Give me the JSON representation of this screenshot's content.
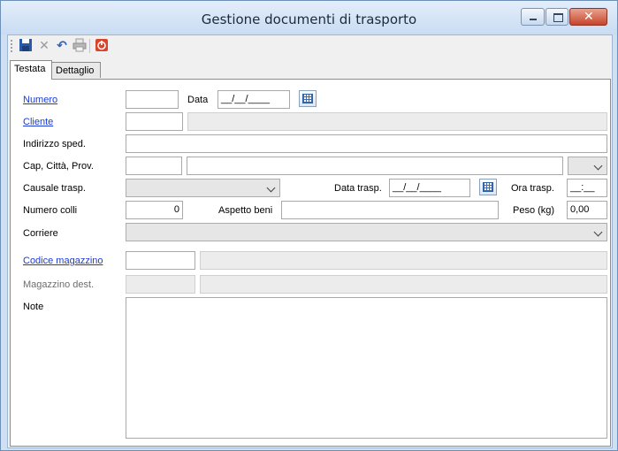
{
  "window": {
    "title": "Gestione documenti di trasporto"
  },
  "toolbar": {
    "save_icon": "save-icon",
    "delete_icon": "delete-icon",
    "undo_icon": "undo-icon",
    "print_icon": "print-icon",
    "exit_icon": "power-icon"
  },
  "tabs": [
    {
      "label": "Testata"
    },
    {
      "label": "Dettaglio"
    }
  ],
  "form": {
    "numero": {
      "label": "Numero",
      "value": ""
    },
    "data": {
      "label": "Data",
      "value": "__/__/____"
    },
    "cliente": {
      "label": "Cliente",
      "code": "",
      "name": ""
    },
    "indirizzo": {
      "label": "Indirizzo sped.",
      "value": ""
    },
    "cap_citta_prov": {
      "label": "Cap, Città, Prov.",
      "cap": "",
      "citta": "",
      "prov": ""
    },
    "causale": {
      "label": "Causale trasp.",
      "value": ""
    },
    "data_trasp": {
      "label": "Data trasp.",
      "value": "__/__/____"
    },
    "ora_trasp": {
      "label": "Ora trasp.",
      "value": "__:__"
    },
    "numero_colli": {
      "label": "Numero colli",
      "value": "0"
    },
    "aspetto_beni": {
      "label": "Aspetto beni",
      "value": ""
    },
    "peso": {
      "label": "Peso (kg)",
      "value": "0,00"
    },
    "corriere": {
      "label": "Corriere",
      "value": ""
    },
    "codice_magazzino": {
      "label": "Codice magazzino",
      "code": "",
      "name": ""
    },
    "magazzino_dest": {
      "label": "Magazzino dest.",
      "code": "",
      "name": ""
    },
    "note": {
      "label": "Note",
      "value": ""
    }
  },
  "colors": {
    "link": "#1a3bd6",
    "titlebar": "#c9dcf2",
    "close": "#c7442b"
  }
}
